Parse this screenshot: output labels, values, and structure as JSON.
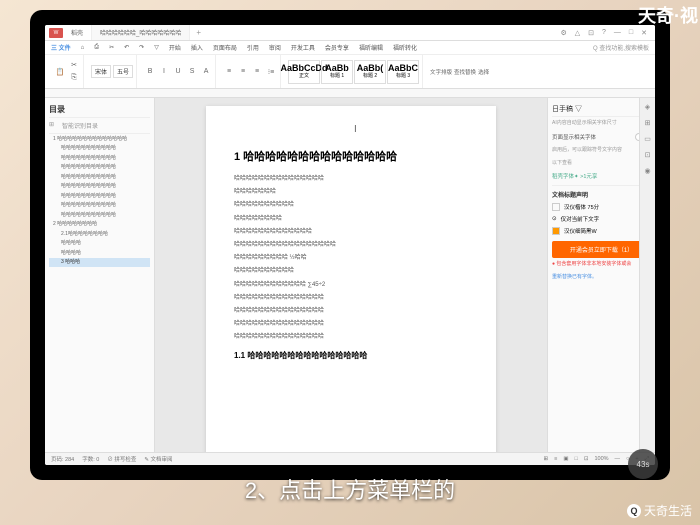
{
  "watermarks": {
    "tr": "天奇·视",
    "br": "天奇生活",
    "br_icon": "Q"
  },
  "subtitle": "2、点击上方菜单栏的",
  "timer": "43s",
  "titlebar": {
    "logo": "W",
    "tab1": "稻壳",
    "tab2": "哈哈哈哈哈哈_哈哈哈哈哈哈哈",
    "add": "+"
  },
  "menu": [
    "三 文件",
    "⌂",
    "⎙",
    "✂",
    "↶",
    "↷",
    "▽",
    "开始",
    "插入",
    "页面布局",
    "引用",
    "审阅",
    "开发工具",
    "会员专享",
    "福昕编辑",
    "福昕转化",
    "Q 查找功能,搜索模板"
  ],
  "right_menu": [
    "⚙",
    "△",
    "⊡",
    "?",
    "—",
    "□",
    "✕"
  ],
  "toolbar": {
    "paste": "粘贴",
    "cut": "✂",
    "copy": "⎘",
    "brush": "格式刷",
    "font": "宋体",
    "size": "五号",
    "bold": "B",
    "italic": "I",
    "underline": "U",
    "strike": "S",
    "super": "x²",
    "sub": "x₂",
    "color": "A",
    "highlight": "ab",
    "align_l": "≡",
    "align_c": "≡",
    "align_r": "≡",
    "list": "⁝≡",
    "indent": "→|",
    "styles": [
      {
        "big": "AaBbCcDd",
        "small": "正文"
      },
      {
        "big": "AaBb",
        "small": "标题 1"
      },
      {
        "big": "AaBb(",
        "small": "标题 2"
      },
      {
        "big": "AaBbC",
        "small": "标题 3"
      }
    ],
    "end_btns": [
      "文字排版",
      "查找替换",
      "选择"
    ]
  },
  "sidebar": {
    "title": "目录",
    "tabs": [
      "⊞",
      "智能识别目录"
    ],
    "items": [
      {
        "l": 1,
        "t": "1 哈哈哈哈哈哈哈哈哈哈哈哈哈哈"
      },
      {
        "l": 2,
        "t": "哈哈哈哈哈哈哈哈哈哈哈"
      },
      {
        "l": 2,
        "t": "哈哈哈哈哈哈哈哈哈哈哈"
      },
      {
        "l": 2,
        "t": "哈哈哈哈哈哈哈哈哈哈哈"
      },
      {
        "l": 2,
        "t": "哈哈哈哈哈哈哈哈哈哈哈"
      },
      {
        "l": 2,
        "t": "哈哈哈哈哈哈哈哈哈哈哈"
      },
      {
        "l": 2,
        "t": "哈哈哈哈哈哈哈哈哈哈哈"
      },
      {
        "l": 2,
        "t": "哈哈哈哈哈哈哈哈哈哈哈"
      },
      {
        "l": 2,
        "t": "哈哈哈哈哈哈哈哈哈哈哈"
      },
      {
        "l": 1,
        "t": "2 哈哈哈哈哈哈哈哈"
      },
      {
        "l": 2,
        "t": "2.1哈哈哈哈哈哈哈哈"
      },
      {
        "l": 2,
        "t": "哈哈哈哈"
      },
      {
        "l": 2,
        "t": "哈哈哈哈"
      },
      {
        "l": 2,
        "t": "3 哈哈哈",
        "sel": true
      }
    ]
  },
  "doc": {
    "cursor": "I",
    "h1": "1 哈哈哈哈哈哈哈哈哈哈哈哈哈哈",
    "p1": "哈哈哈哈哈哈哈哈哈哈哈哈哈哈哈",
    "p2": "哈哈哈哈哈哈哈",
    "p3": "哈哈哈哈哈哈哈哈哈哈",
    "p4": "哈哈哈哈哈哈哈哈",
    "p5": "哈哈哈哈哈哈哈哈哈哈哈哈哈",
    "p6": "哈哈哈哈哈哈哈哈哈哈哈哈哈哈哈哈哈",
    "p7": "哈哈哈哈哈哈哈哈哈    ½哈哈",
    "p8": "哈哈哈哈哈哈哈哈哈哈",
    "p9": "哈哈哈哈哈哈哈哈哈哈哈哈  ∑45÷2",
    "p10": "哈哈哈哈哈哈哈哈哈哈哈哈哈哈哈",
    "p11": "哈哈哈哈哈哈哈哈哈哈哈哈哈哈哈",
    "p12": "哈哈哈哈哈哈哈哈哈哈哈哈哈哈哈",
    "p13": "哈哈哈哈哈哈哈哈哈哈哈哈哈哈哈",
    "h2": "1.1 哈哈哈哈哈哈哈哈哈哈哈哈哈哈哈"
  },
  "rpanel": {
    "title": "日手稿 ▽",
    "close": "✕",
    "hint": "AI内容自动显示相关字体尺寸",
    "opt1": "页面显示相关字体",
    "opt2": "启用后，可以跟踪符号文字内容",
    "opt3": "以下查看",
    "link": "稻壳字体✦  >1元享",
    "sec": "文档标题声明",
    "style1": "汉仪楷体 75分",
    "style2": "仅对当前下文字",
    "style2b": "⊙",
    "style3": "汉仪细简黑W",
    "btn": "开通会员立即下载（1）",
    "warn": "● 包含套用字体非本地安装字体或会",
    "warn2": "重新替换已有字体。"
  },
  "status": {
    "page": "页码: 284",
    "words": "字数: 0",
    "spell": "⊘ 拼写检查",
    "mode": "✎ 文档审阅",
    "right": [
      "⊞",
      "≡",
      "▣",
      "□",
      "⊡",
      "100%",
      "—",
      "○",
      "+",
      "⤢"
    ]
  }
}
